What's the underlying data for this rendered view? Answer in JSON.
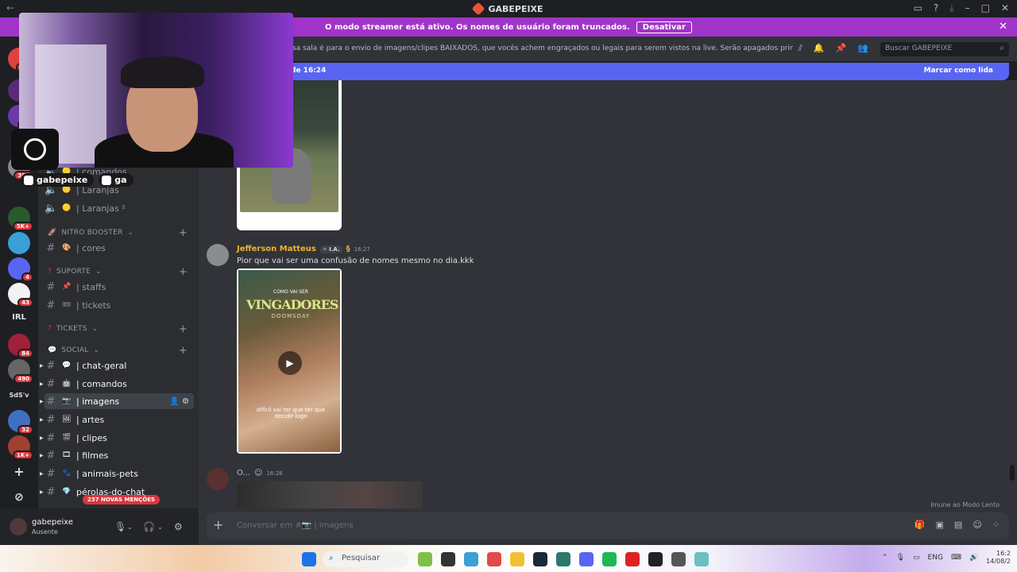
{
  "window": {
    "title": "GABEPEIXE",
    "back": "←"
  },
  "streamer_banner": {
    "text": "O modo streamer está ativo. Os nomes de usuário foram truncados.",
    "button": "Desativar",
    "close": "✕"
  },
  "rail": {
    "badges": [
      "NO",
      "1",
      "24",
      "363",
      "5K+",
      "4",
      "43",
      "84",
      "490",
      "32",
      "1K+"
    ],
    "labels": [
      "IRL",
      "SdS'v"
    ]
  },
  "sidebar": {
    "voice_channels": [
      {
        "label": "| comandos"
      },
      {
        "label": "| Laranjas"
      },
      {
        "label": "| Laranjas ²"
      }
    ],
    "categories": {
      "nitro": "NITRO BOOSTER",
      "suporte": "SUPORTE",
      "tickets": "TICKETS",
      "social": "SOCIAL"
    },
    "channels": {
      "cores": "| cores",
      "staffs": "| staffs",
      "tickets": "| tickets",
      "chat_geral": "| chat-geral",
      "comandos": "| comandos",
      "imagens": "| imagens",
      "artes": "| artes",
      "clipes": "| clipes",
      "filmes": "| filmes",
      "animais": "| animais-pets",
      "perolas": "pérolas-do-chat"
    },
    "mentions_badge": "237 NOVAS MENÇÕES"
  },
  "user_panel": {
    "name": "gabepeixe",
    "status": "Ausente"
  },
  "header": {
    "topic": "sa sala é para o envio de imagens/clipes BAIXADOS, que vocês achem engraçados ou legais para serem vistos na live. Serão apagados prints de outras rede...",
    "search_placeholder": "Buscar GABEPEIXE"
  },
  "unread_bar": {
    "left": "de 16:24",
    "right": "Marcar como lida"
  },
  "messages": [
    {
      "author": "Jefferson Matteus",
      "tag": "✧ I.A.",
      "time": "16:27",
      "text": "Pior que vai ser uma confusão de nomes mesmo no dia.kkk",
      "video": {
        "line1": "COMO VAI SER",
        "line2": "VINGADORES",
        "line3": "DOOMSDAY",
        "caption": "difícil vai ter que ter que decidir logo"
      }
    },
    {
      "author": "O...",
      "time": "16:28"
    }
  ],
  "slowmode": "Imune ao Modo Lento",
  "composer": {
    "placeholder": "Conversar em #📷 | imagens"
  },
  "webcam": {
    "socials": [
      "gabepeixe",
      "ga"
    ]
  },
  "taskbar": {
    "search": "Pesquisar",
    "lang": "ENG",
    "time": "16:2",
    "date": "14/08/2"
  }
}
